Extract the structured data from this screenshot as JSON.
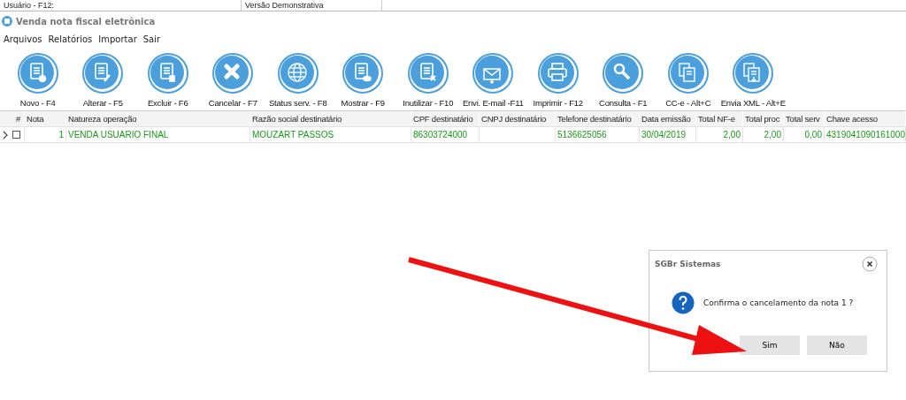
{
  "top_strip": {
    "user_label": "Usuário - F12:",
    "version": "Versão Demonstrativa"
  },
  "window": {
    "title": "Venda nota fiscal eletrônica"
  },
  "menu": [
    "Arquivos",
    "Relatórios",
    "Importar",
    "Sair"
  ],
  "toolbar": [
    {
      "label": "Novo - F4",
      "kind": "new"
    },
    {
      "label": "Alterar - F5",
      "kind": "edit"
    },
    {
      "label": "Excluir - F6",
      "kind": "delete"
    },
    {
      "label": "Cancelar - F7",
      "kind": "cancel"
    },
    {
      "label": "Status serv. - F8",
      "kind": "globe"
    },
    {
      "label": "Mostrar - F9",
      "kind": "view"
    },
    {
      "label": "Inutilizar - F10",
      "kind": "void"
    },
    {
      "label": "Envi. E-mail -F11",
      "kind": "mail"
    },
    {
      "label": "Imprimir - F12",
      "kind": "print"
    },
    {
      "label": "Consulta - F1",
      "kind": "search"
    },
    {
      "label": "CC-e - Alt+C",
      "kind": "copy"
    },
    {
      "label": "Envia XML - Alt+E",
      "kind": "xml"
    }
  ],
  "table": {
    "columns": [
      "#",
      "Nota",
      "Natureza operação",
      "Razão social destinatário",
      "CPF destinatário",
      "CNPJ destinatário",
      "Telefone destinatário",
      "Data emissão",
      "Total NF-e",
      "Total proc",
      "Total serv",
      "Chave acesso"
    ],
    "rows": [
      {
        "selected": true,
        "checked": false,
        "cells": [
          "",
          "1",
          "VENDA USUARIO FINAL",
          "MOUZART PASSOS",
          "86303724000",
          "",
          "5136625056",
          "30/04/2019",
          "2,00",
          "2,00",
          "0,00",
          "4319041090161000"
        ]
      }
    ]
  },
  "dialog": {
    "title": "SGBr Sistemas",
    "message": "Confirma o cancelamento da nota 1 ?",
    "buttons": [
      "Sim",
      "Não"
    ]
  }
}
